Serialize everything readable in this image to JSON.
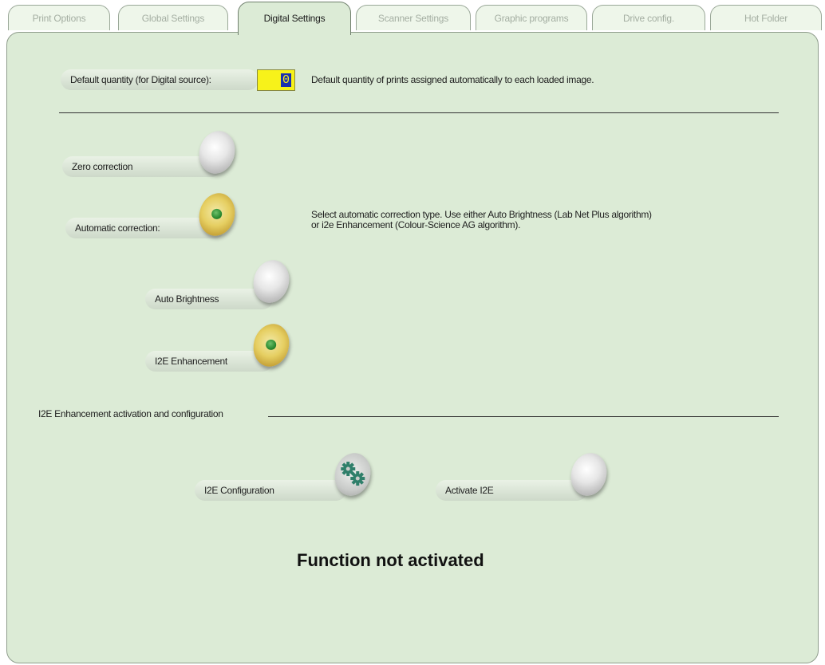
{
  "tabs": [
    {
      "label": "Print Options"
    },
    {
      "label": "Global Settings"
    },
    {
      "label": "Digital Settings"
    },
    {
      "label": "Scanner Settings"
    },
    {
      "label": "Graphic programs"
    },
    {
      "label": "Drive config."
    },
    {
      "label": "Hot Folder"
    }
  ],
  "active_tab": "Digital Settings",
  "default_quantity": {
    "label": "Default quantity (for Digital source):",
    "value": "0",
    "description": "Default quantity of prints assigned automatically to each loaded image."
  },
  "zero_correction": {
    "label": "Zero correction",
    "selected": false
  },
  "automatic_correction": {
    "label": "Automatic correction:",
    "selected": true,
    "description_line1": "Select automatic correction type. Use either Auto Brightness (Lab Net Plus algorithm)",
    "description_line2": "or i2e Enhancement (Colour-Science AG algorithm)."
  },
  "auto_brightness": {
    "label": "Auto Brightness",
    "selected": false
  },
  "i2e_enhancement": {
    "label": "I2E Enhancement",
    "selected": true
  },
  "i2e_section": {
    "title": "I2E Enhancement activation and configuration",
    "configuration_label": "I2E Configuration",
    "activate_label": "Activate I2E",
    "activate_selected": false
  },
  "status_text": "Function not activated",
  "colors": {
    "panel_bg": "#dcebd6",
    "quantity_field_bg": "#f7f21a",
    "selection_highlight": "#1a2fb0"
  }
}
